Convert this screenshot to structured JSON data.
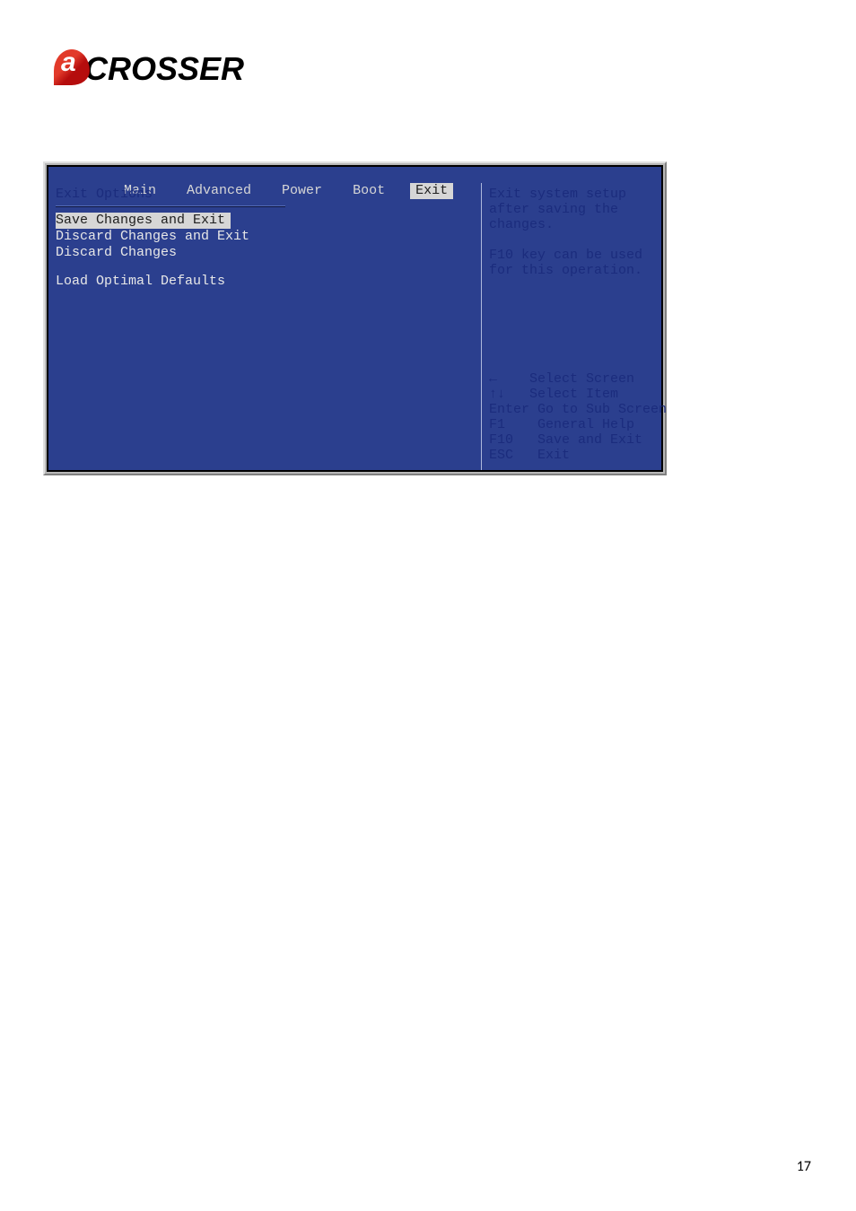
{
  "logo_text": "CROSSER",
  "page_number": "17",
  "bios": {
    "tabs": [
      "Main",
      "Advanced",
      "Power",
      "Boot",
      "Exit"
    ],
    "selected_tab": "Exit",
    "left": {
      "section_title": "Exit Options",
      "items": [
        "Save Changes and Exit",
        "Discard Changes and Exit",
        "Discard Changes",
        "",
        "Load Optimal Defaults"
      ],
      "selected_index": 0
    },
    "right": {
      "help": "Exit system setup\nafter saving the\nchanges.\n\nF10 key can be used\nfor this operation.",
      "nav": [
        {
          "key": "←",
          "action": "Select Screen"
        },
        {
          "key": "↑↓",
          "action": "Select Item"
        },
        {
          "key": "Enter",
          "action": "Go to Sub Screen"
        },
        {
          "key": "F1",
          "action": "General Help"
        },
        {
          "key": "F10",
          "action": "Save and Exit"
        },
        {
          "key": "ESC",
          "action": "Exit"
        }
      ]
    }
  }
}
